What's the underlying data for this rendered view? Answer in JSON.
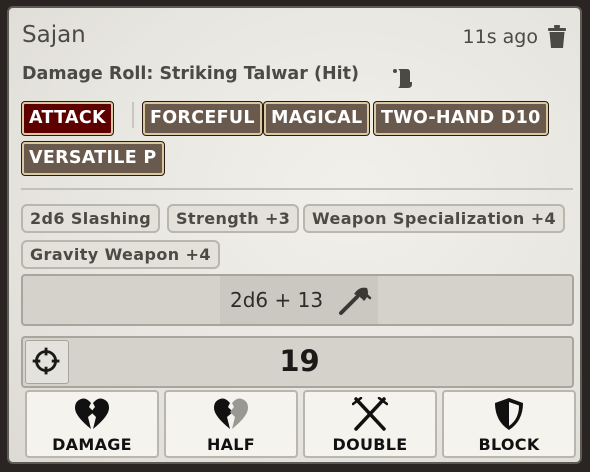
{
  "message": {
    "sender": "Sajan",
    "timestamp": "11s ago",
    "flavor": "Damage Roll: Striking Talwar (Hit)"
  },
  "traits": [
    "ATTACK",
    "FORCEFUL",
    "MAGICAL",
    "TWO-HAND D10",
    "VERSATILE P"
  ],
  "modifiers": [
    "2d6 Slashing",
    "Strength +3",
    "Weapon Specialization +4",
    "Gravity Weapon +4"
  ],
  "roll": {
    "formula": "2d6 + 13",
    "total": "19",
    "damage_type_icon": "axe-icon"
  },
  "buttons": {
    "damage": "DAMAGE",
    "half": "HALF",
    "double": "DOUBLE",
    "block": "BLOCK"
  },
  "colors": {
    "attack_trait": "#5e0000",
    "trait": "#6a5a4e",
    "card_bg": "#ecebe5"
  }
}
